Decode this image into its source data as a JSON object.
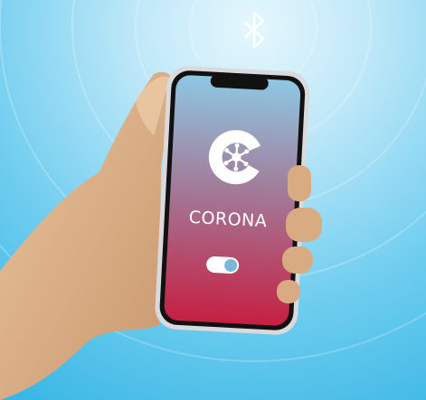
{
  "scene": {
    "app_name": "CORONA",
    "icons": [
      "bluetooth-icon",
      "corona-virus-logo-icon",
      "toggle-switch"
    ],
    "toggle": {
      "state": "on"
    },
    "colors": {
      "background_outer": "#2fb3e3",
      "background_inner": "#e6f7fd",
      "screen_top": "#8ec8e3",
      "screen_bottom": "#c61f42",
      "phone_frame": "#d9d9de",
      "skin": "#e0b890",
      "toggle_knob": "#7ab7d8"
    }
  }
}
